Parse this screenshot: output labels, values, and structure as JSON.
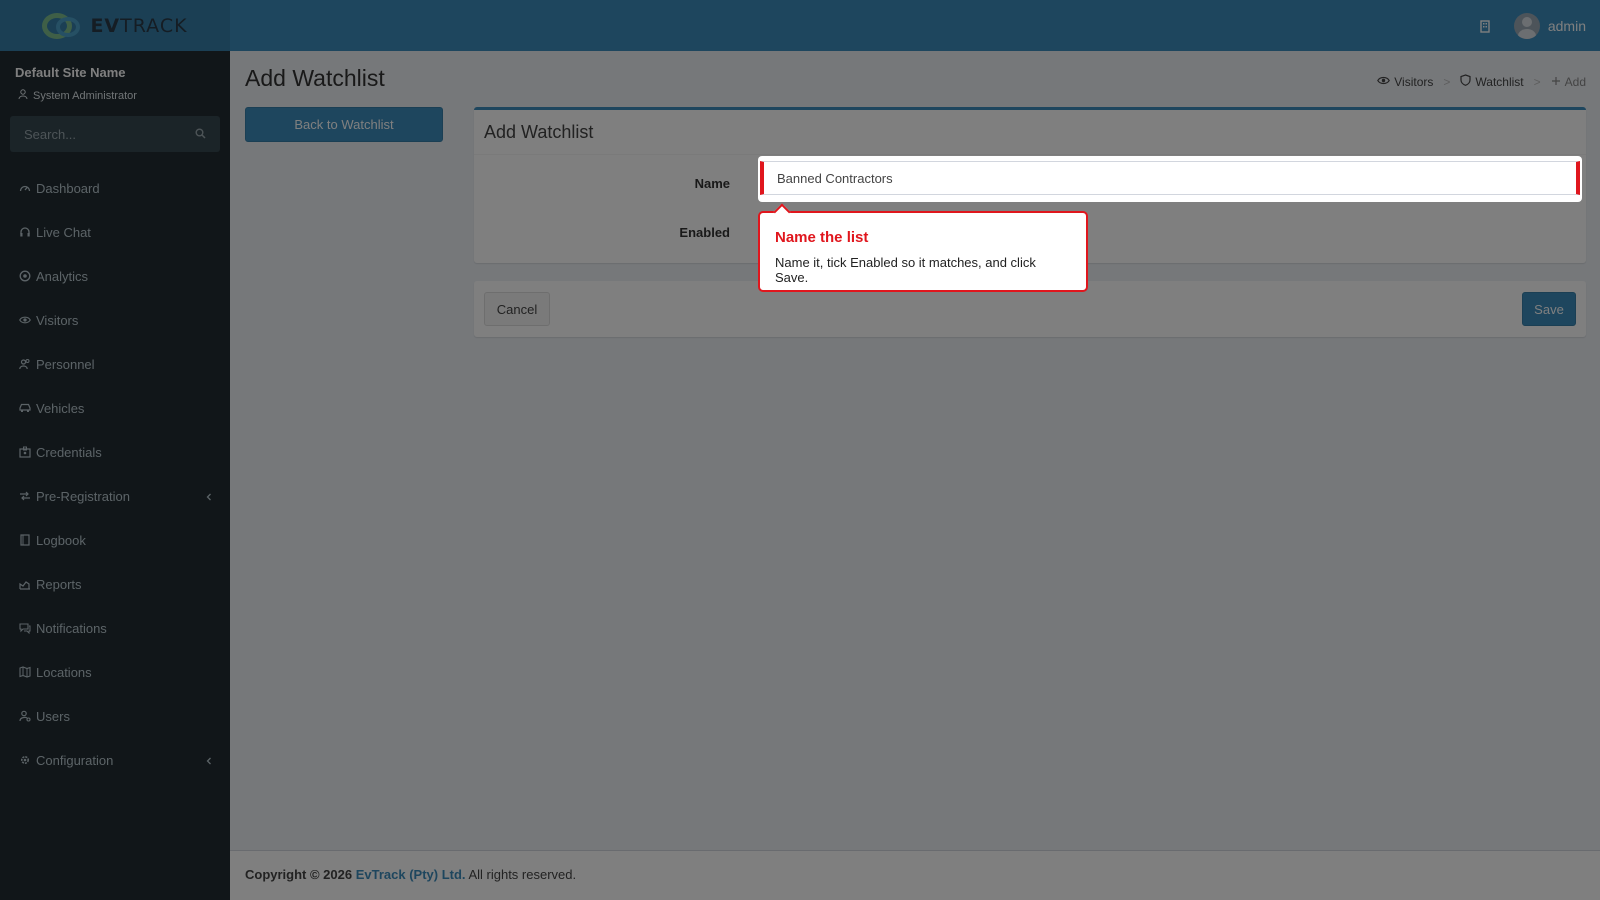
{
  "brand": {
    "logo_part1": "EV",
    "logo_part2": "TRACK"
  },
  "header": {
    "username": "admin"
  },
  "sidebar": {
    "site_name": "Default Site Name",
    "role": "System Administrator",
    "search_placeholder": "Search...",
    "items": [
      {
        "label": "Dashboard",
        "icon": "dashboard-icon"
      },
      {
        "label": "Live Chat",
        "icon": "headset-icon"
      },
      {
        "label": "Analytics",
        "icon": "target-icon"
      },
      {
        "label": "Visitors",
        "icon": "eye-icon"
      },
      {
        "label": "Personnel",
        "icon": "users-icon"
      },
      {
        "label": "Vehicles",
        "icon": "car-icon"
      },
      {
        "label": "Credentials",
        "icon": "id-card-icon"
      },
      {
        "label": "Pre-Registration",
        "icon": "swap-icon"
      },
      {
        "label": "Logbook",
        "icon": "book-icon"
      },
      {
        "label": "Reports",
        "icon": "chart-icon"
      },
      {
        "label": "Notifications",
        "icon": "chat-icon"
      },
      {
        "label": "Locations",
        "icon": "map-icon"
      },
      {
        "label": "Users",
        "icon": "user-cog-icon"
      },
      {
        "label": "Configuration",
        "icon": "gear-icon"
      }
    ]
  },
  "page": {
    "title": "Add Watchlist",
    "back_label": "Back to Watchlist",
    "breadcrumb": [
      {
        "label": "Visitors"
      },
      {
        "label": "Watchlist"
      },
      {
        "label": "Add"
      }
    ]
  },
  "form": {
    "title": "Add Watchlist",
    "name_label": "Name",
    "name_value": "Banned Contractors",
    "enabled_label": "Enabled",
    "cancel_label": "Cancel",
    "save_label": "Save"
  },
  "tooltip": {
    "title": "Name the list",
    "body": "Name it, tick Enabled so it matches, and click Save."
  },
  "footer": {
    "copyright": "Copyright © 2026",
    "company": "EvTrack (Pty) Ltd.",
    "rights": "All rights reserved."
  },
  "colors": {
    "header": "#3c8dbc",
    "sidebar": "#222d32",
    "accent": "#3c8dbc",
    "highlight": "#e0161d"
  }
}
